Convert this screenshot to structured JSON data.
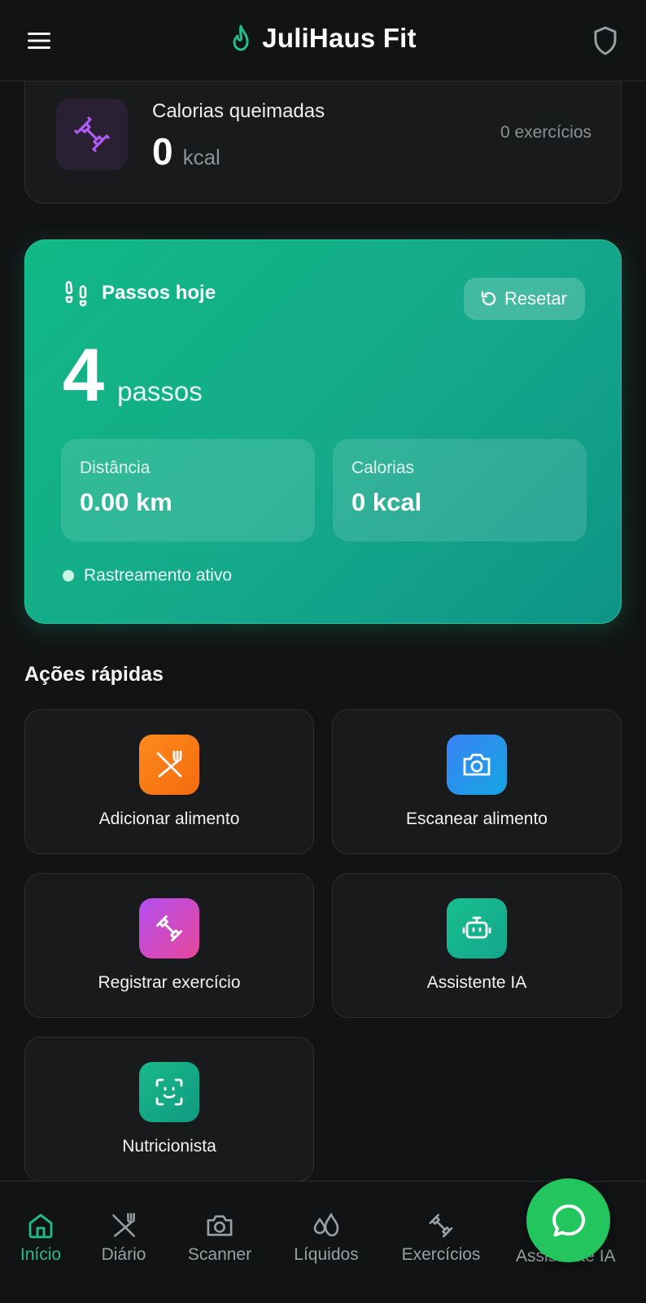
{
  "header": {
    "title": "JuliHaus Fit",
    "menu_icon": "menu-icon",
    "logo_icon": "flame-icon",
    "shield_icon": "shield-icon"
  },
  "burned": {
    "label": "Calorias queimadas",
    "value": "0",
    "unit": "kcal",
    "count": "0 exercícios",
    "icon": "dumbbell-icon"
  },
  "steps": {
    "title": "Passos hoje",
    "reset_label": "Resetar",
    "count": "4",
    "unit": "passos",
    "distance_label": "Distância",
    "distance_value": "0.00 km",
    "calories_label": "Calorias",
    "calories_value": "0 kcal",
    "tracking_status": "Rastreamento ativo"
  },
  "quick_actions": {
    "title": "Ações rápidas",
    "items": [
      {
        "label": "Adicionar alimento",
        "icon": "utensils-crossed-icon"
      },
      {
        "label": "Escanear alimento",
        "icon": "camera-icon"
      },
      {
        "label": "Registrar exercício",
        "icon": "dumbbell-icon"
      },
      {
        "label": "Assistente IA",
        "icon": "bot-icon"
      },
      {
        "label": "Nutricionista",
        "icon": "face-scan-icon"
      }
    ]
  },
  "nav": {
    "items": [
      {
        "label": "Início",
        "icon": "home-icon",
        "active": true
      },
      {
        "label": "Diário",
        "icon": "utensils-crossed-icon"
      },
      {
        "label": "Scanner",
        "icon": "camera-icon"
      },
      {
        "label": "Líquidos",
        "icon": "droplets-icon"
      },
      {
        "label": "Exercícios",
        "icon": "dumbbell-icon"
      },
      {
        "label": "Assistente IA",
        "icon": "bot-icon"
      }
    ]
  },
  "fab": {
    "icon": "whatsapp-chat-icon"
  },
  "colors": {
    "background": "#121314",
    "card": "#181a1b",
    "accent": "#1fbf8c",
    "steps_gradient_start": "#12b886",
    "steps_gradient_end": "#0e9488",
    "fab": "#22c55e"
  }
}
